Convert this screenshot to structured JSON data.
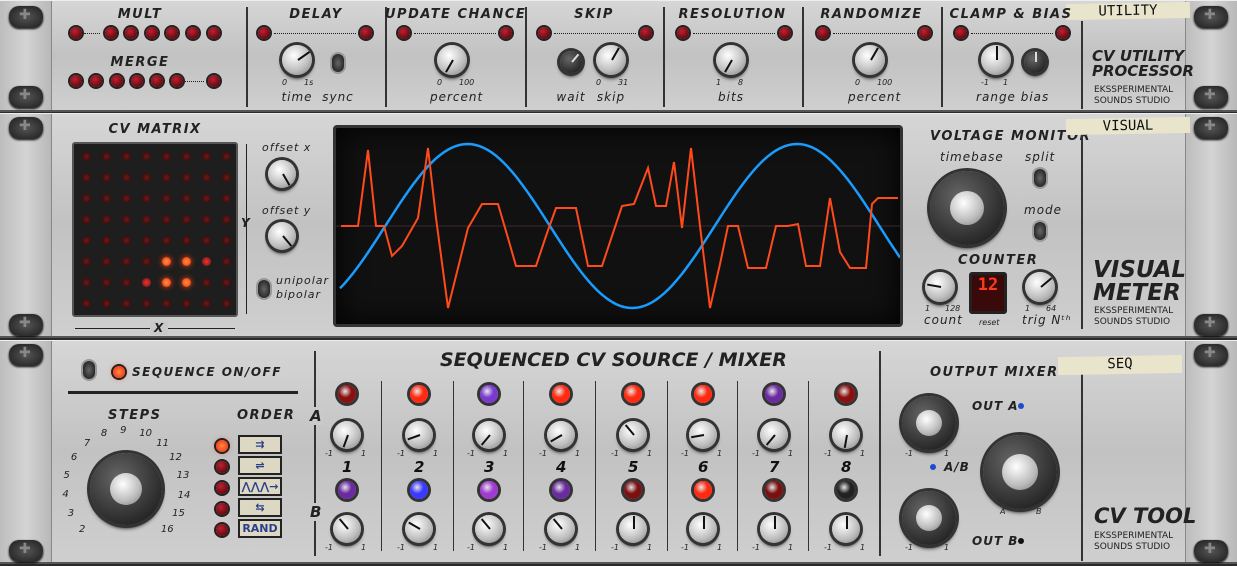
{
  "utility": {
    "tape": "UTILITY",
    "mult": "MULT",
    "merge": "MERGE",
    "delay": {
      "title": "DELAY",
      "min": "0",
      "max": "1s",
      "knob": "time",
      "switch": "sync"
    },
    "update": {
      "title": "UPDATE CHANCE",
      "min": "0",
      "max": "100",
      "knob": "percent"
    },
    "skip": {
      "title": "SKIP",
      "min": "0",
      "max": "31",
      "knob1": "wait",
      "knob2": "skip"
    },
    "resolution": {
      "title": "RESOLUTION",
      "min": "1",
      "max": "8",
      "knob": "bits"
    },
    "randomize": {
      "title": "RANDOMIZE",
      "min": "0",
      "max": "100",
      "knob": "percent"
    },
    "clamp": {
      "title": "CLAMP & BIAS",
      "min": "-1",
      "max": "1",
      "knob1": "range",
      "knob2": "bias"
    },
    "brand": [
      "CV UTILITY",
      "PROCESSOR"
    ],
    "studio": [
      "EKSSPERIMENTAL",
      "SOUNDS STUDIO"
    ]
  },
  "visual": {
    "tape": "VISUAL",
    "matrix": {
      "title": "CV MATRIX",
      "x": "X",
      "y": "Y",
      "offset_x": "offset x",
      "offset_y": "offset y",
      "unipolar": "unipolar",
      "bipolar": "bipolar"
    },
    "monitor": {
      "title": "VOLTAGE MONITOR",
      "timebase": "timebase",
      "split": "split",
      "mode": "mode"
    },
    "counter": {
      "title": "COUNTER",
      "display": "12",
      "count": "count",
      "count_min": "1",
      "count_max": "128",
      "reset": "reset",
      "trig": "trig Nᵗʰ",
      "trig_min": "1",
      "trig_max": "64"
    },
    "brand": [
      "VISUAL",
      "METER"
    ],
    "studio": [
      "EKSSPERIMENTAL",
      "SOUNDS STUDIO"
    ],
    "colors": {
      "trace_a": "#ff4a1c",
      "trace_b": "#1a9cff"
    }
  },
  "seq": {
    "tape": "SEQ",
    "seq_onoff": "SEQUENCE ON/OFF",
    "title": "SEQUENCED CV SOURCE / MIXER",
    "steps": "STEPS",
    "step_labels": [
      "2",
      "3",
      "4",
      "5",
      "6",
      "7",
      "8",
      "9",
      "10",
      "11",
      "12",
      "13",
      "14",
      "15",
      "16"
    ],
    "order": "ORDER",
    "order_rand": "RAND",
    "row_a": "A",
    "row_b": "B",
    "knob_min": "-1",
    "knob_max": "1",
    "step_numbers": [
      "1",
      "2",
      "3",
      "4",
      "5",
      "6",
      "7",
      "8"
    ],
    "pads_a": [
      "#8a1010",
      "#ff2a10",
      "#7a3ad0",
      "#ff2a10",
      "#ff2a10",
      "#ff2a10",
      "#6a2aa0",
      "#8a1010"
    ],
    "pads_b": [
      "#6a2aa0",
      "#3a3aff",
      "#a03ad0",
      "#6a2aa0",
      "#7a1010",
      "#ff2a10",
      "#7a1010",
      "#222222"
    ],
    "output": {
      "title": "OUTPUT MIXER",
      "out_a": "OUT A",
      "out_b": "OUT B",
      "ab": "A/B",
      "a": "A",
      "b": "B",
      "min": "-1",
      "max": "1"
    },
    "brand": [
      "CV TOOL"
    ],
    "studio": [
      "EKSSPERIMENTAL",
      "SOUNDS STUDIO"
    ]
  }
}
